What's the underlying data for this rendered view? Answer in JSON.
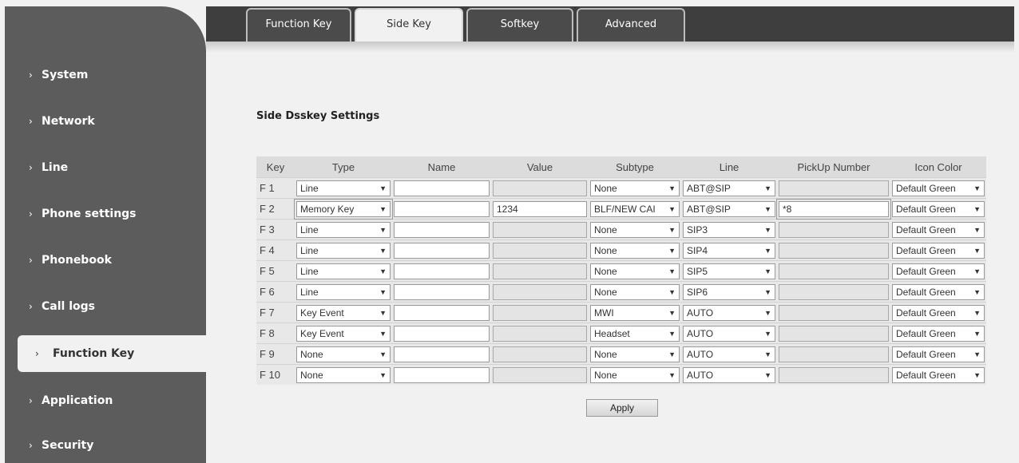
{
  "sidebar": {
    "items": [
      {
        "label": "System"
      },
      {
        "label": "Network"
      },
      {
        "label": "Line"
      },
      {
        "label": "Phone settings"
      },
      {
        "label": "Phonebook"
      },
      {
        "label": "Call logs"
      },
      {
        "label": "Function Key",
        "active": true
      },
      {
        "label": "Application"
      },
      {
        "label": "Security"
      }
    ],
    "chevron": "›"
  },
  "tabs": [
    {
      "label": "Function Key"
    },
    {
      "label": "Side Key",
      "active": true
    },
    {
      "label": "Softkey"
    },
    {
      "label": "Advanced"
    }
  ],
  "section_title": "Side Dsskey Settings",
  "table": {
    "headers": [
      "Key",
      "Type",
      "Name",
      "Value",
      "Subtype",
      "Line",
      "PickUp Number",
      "Icon Color"
    ],
    "rows": [
      {
        "key": "F 1",
        "type": "Line",
        "name": "",
        "value": "",
        "subtype": "None",
        "line": "ABT@SIP",
        "pickup": "",
        "icon_color": "Default Green"
      },
      {
        "key": "F 2",
        "type": "Memory Key",
        "name": "",
        "value": "1234",
        "subtype": "BLF/NEW CAI",
        "line": "ABT@SIP",
        "pickup": "*8",
        "icon_color": "Default Green"
      },
      {
        "key": "F 3",
        "type": "Line",
        "name": "",
        "value": "",
        "subtype": "None",
        "line": "SIP3",
        "pickup": "",
        "icon_color": "Default Green"
      },
      {
        "key": "F 4",
        "type": "Line",
        "name": "",
        "value": "",
        "subtype": "None",
        "line": "SIP4",
        "pickup": "",
        "icon_color": "Default Green"
      },
      {
        "key": "F 5",
        "type": "Line",
        "name": "",
        "value": "",
        "subtype": "None",
        "line": "SIP5",
        "pickup": "",
        "icon_color": "Default Green"
      },
      {
        "key": "F 6",
        "type": "Line",
        "name": "",
        "value": "",
        "subtype": "None",
        "line": "SIP6",
        "pickup": "",
        "icon_color": "Default Green"
      },
      {
        "key": "F 7",
        "type": "Key Event",
        "name": "",
        "value": "",
        "subtype": "MWI",
        "line": "AUTO",
        "pickup": "",
        "icon_color": "Default Green"
      },
      {
        "key": "F 8",
        "type": "Key Event",
        "name": "",
        "value": "",
        "subtype": "Headset",
        "line": "AUTO",
        "pickup": "",
        "icon_color": "Default Green"
      },
      {
        "key": "F 9",
        "type": "None",
        "name": "",
        "value": "",
        "subtype": "None",
        "line": "AUTO",
        "pickup": "",
        "icon_color": "Default Green"
      },
      {
        "key": "F 10",
        "type": "None",
        "name": "",
        "value": "",
        "subtype": "None",
        "line": "AUTO",
        "pickup": "",
        "icon_color": "Default Green"
      }
    ]
  },
  "apply_label": "Apply",
  "dropdown_arrow": "▼",
  "colors": {
    "sidebar_bg": "#5c5c5c",
    "topbar_bg": "#3e3e3e",
    "page_bg": "#f1f1f1"
  }
}
